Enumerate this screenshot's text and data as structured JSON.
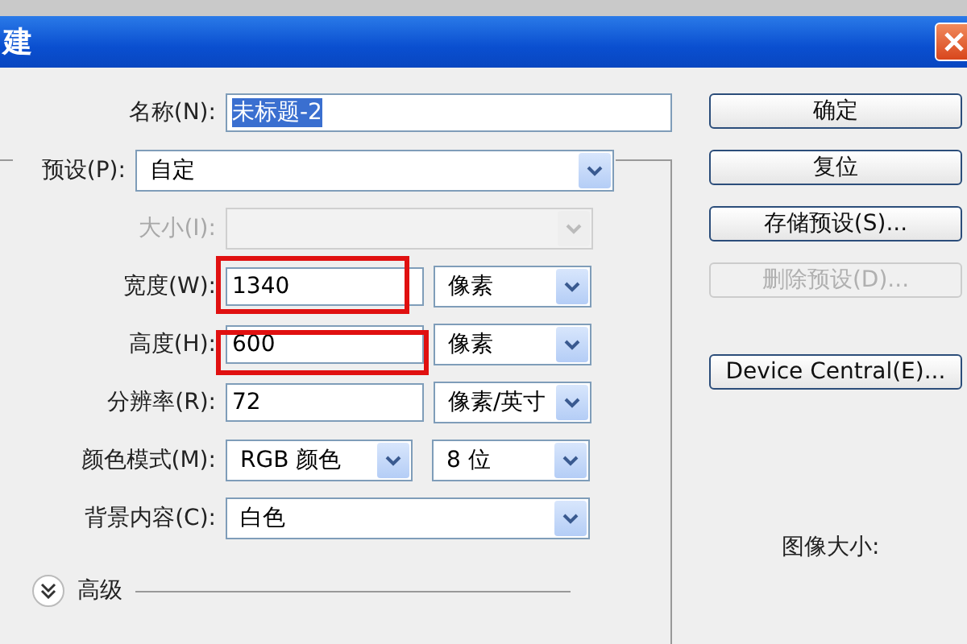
{
  "window": {
    "title": "建"
  },
  "name_field": {
    "label": "名称(N):",
    "value": "未标题-2",
    "selected": true
  },
  "preset": {
    "label": "预设(P):",
    "value": "自定"
  },
  "rows": [
    {
      "kind": "select",
      "label": "大小(I):",
      "disabled": true
    },
    {
      "kind": "input-unit",
      "label": "宽度(W):",
      "value": "1340",
      "unit": "像素",
      "highlighted": true
    },
    {
      "kind": "input-unit",
      "label": "高度(H):",
      "value": "600",
      "unit": "像素",
      "highlighted": true
    },
    {
      "kind": "input-unit",
      "label": "分辨率(R):",
      "value": "72",
      "unit": "像素/英寸",
      "highlighted": false
    },
    {
      "kind": "select-pair",
      "label": "颜色模式(M):",
      "value": "RGB 颜色",
      "unit": "8 位"
    },
    {
      "kind": "select",
      "label": "背景内容(C):",
      "value": "白色",
      "disabled": false
    }
  ],
  "advanced": {
    "label": "高级",
    "expanded": false
  },
  "buttons": [
    {
      "label": "确定",
      "disabled": false
    },
    {
      "label": "复位",
      "disabled": false
    },
    {
      "label": "存储预设(S)...",
      "disabled": false
    },
    {
      "label": "删除预设(D)...",
      "disabled": true
    },
    {
      "label": "Device Central(E)...",
      "disabled": false
    }
  ],
  "image_size_label": "图像大小:"
}
